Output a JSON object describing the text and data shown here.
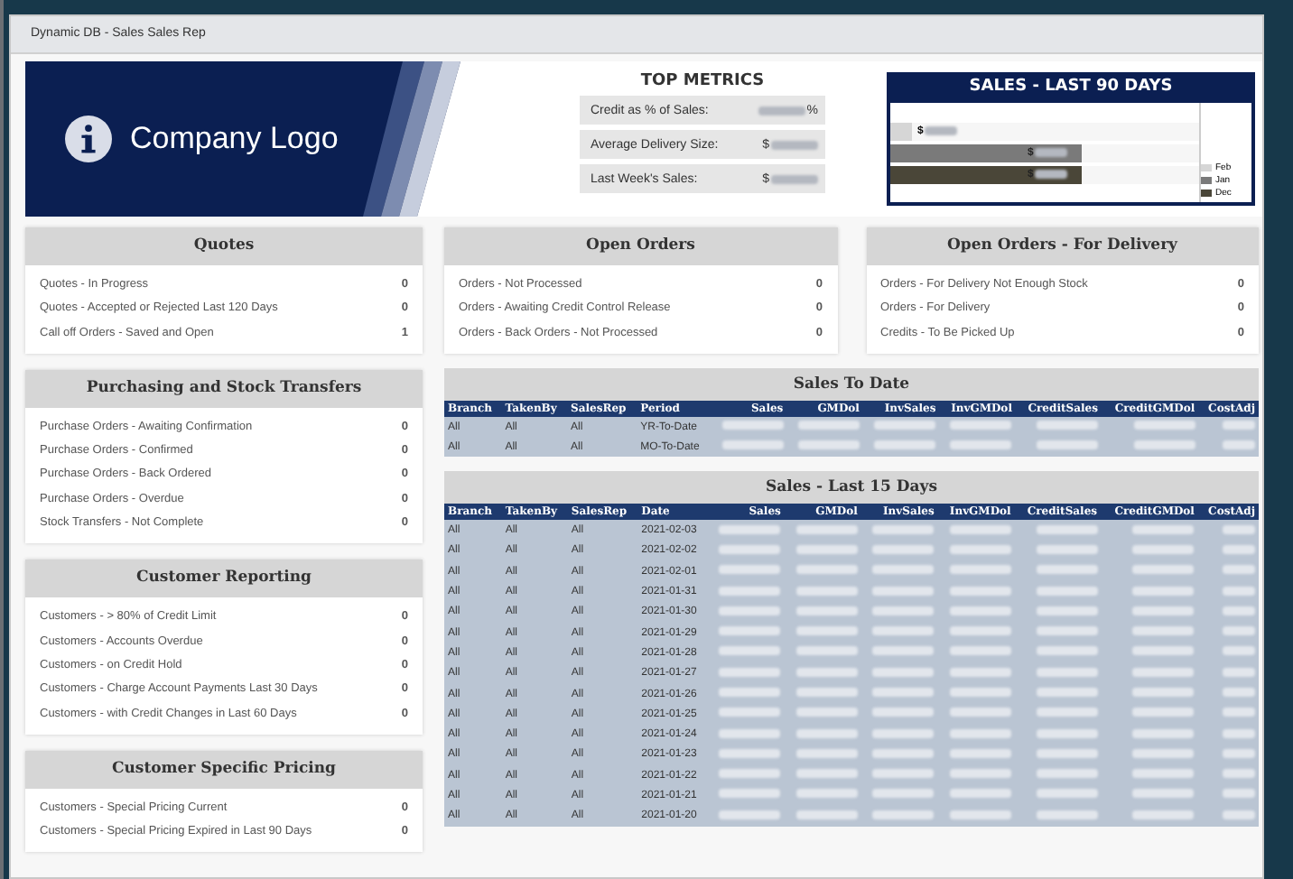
{
  "window": {
    "title": "Dynamic DB - Sales Sales Rep"
  },
  "logo": {
    "text": "Company Logo"
  },
  "top_metrics": {
    "title": "TOP METRICS",
    "items": [
      {
        "label": "Credit as % of Sales:",
        "suffix": "%"
      },
      {
        "label": "Average Delivery Size:",
        "prefix": "$"
      },
      {
        "label": "Last Week's Sales:",
        "prefix": "$"
      }
    ]
  },
  "sales_chart": {
    "title": "SALES - LAST 90 DAYS",
    "bars": [
      {
        "label": "$",
        "color": "#d6d6d6",
        "level": 0.07,
        "legend": "Feb"
      },
      {
        "label": "$",
        "color": "#7a7a7a",
        "level": 0.62,
        "legend": "Jan"
      },
      {
        "label": "$",
        "color": "#4a4638",
        "level": 0.62,
        "legend": "Dec"
      }
    ]
  },
  "left_panels": [
    {
      "title": "Quotes",
      "rows": [
        {
          "label": "Quotes - In Progress",
          "value": "0"
        },
        {
          "label": "Quotes - Accepted or Rejected Last 120 Days",
          "value": "0"
        },
        {
          "label": "Call off Orders - Saved and Open",
          "value": "1"
        }
      ]
    },
    {
      "title": "Purchasing and Stock Transfers",
      "rows": [
        {
          "label": "Purchase Orders - Awaiting Confirmation",
          "value": "0"
        },
        {
          "label": "Purchase Orders - Confirmed",
          "value": "0"
        },
        {
          "label": "Purchase Orders - Back Ordered",
          "value": "0"
        },
        {
          "label": "Purchase Orders - Overdue",
          "value": "0"
        },
        {
          "label": "Stock Transfers - Not Complete",
          "value": "0"
        }
      ]
    },
    {
      "title": "Customer Reporting",
      "rows": [
        {
          "label": "Customers - > 80% of Credit Limit",
          "value": "0"
        },
        {
          "label": "Customers - Accounts Overdue",
          "value": "0"
        },
        {
          "label": "Customers - on Credit Hold",
          "value": "0"
        },
        {
          "label": "Customers - Charge Account Payments Last 30 Days",
          "value": "0"
        },
        {
          "label": "Customers - with Credit Changes in Last 60 Days",
          "value": "0"
        }
      ]
    },
    {
      "title": "Customer Specific Pricing",
      "rows": [
        {
          "label": "Customers - Special Pricing Current",
          "value": "0"
        },
        {
          "label": "Customers - Special Pricing Expired in Last 90 Days",
          "value": "0"
        }
      ]
    }
  ],
  "top_panels": [
    {
      "title": "Open Orders",
      "rows": [
        {
          "label": "Orders - Not Processed",
          "value": "0"
        },
        {
          "label": "Orders - Awaiting Credit Control Release",
          "value": "0"
        },
        {
          "label": "Orders - Back Orders - Not Processed",
          "value": "0"
        }
      ]
    },
    {
      "title": "Open Orders - For Delivery",
      "rows": [
        {
          "label": "Orders - For Delivery Not Enough Stock",
          "value": "0"
        },
        {
          "label": "Orders - For Delivery",
          "value": "0"
        },
        {
          "label": "Credits - To Be Picked Up",
          "value": "0"
        }
      ]
    }
  ],
  "tables": [
    {
      "title": "Sales To Date",
      "columns": [
        "Branch",
        "TakenBy",
        "SalesRep",
        "Period",
        "Sales",
        "GMDol",
        "InvSales",
        "InvGMDol",
        "CreditSales",
        "CreditGMDol",
        "CostAdj"
      ],
      "rows": [
        [
          "All",
          "All",
          "All",
          "YR-To-Date"
        ],
        [
          "All",
          "All",
          "All",
          "MO-To-Date"
        ]
      ]
    },
    {
      "title": "Sales - Last 15 Days",
      "columns": [
        "Branch",
        "TakenBy",
        "SalesRep",
        "Date",
        "Sales",
        "GMDol",
        "InvSales",
        "InvGMDol",
        "CreditSales",
        "CreditGMDol",
        "CostAdj"
      ],
      "rows": [
        [
          "All",
          "All",
          "All",
          "2021-02-03"
        ],
        [
          "All",
          "All",
          "All",
          "2021-02-02"
        ],
        [
          "All",
          "All",
          "All",
          "2021-02-01"
        ],
        [
          "All",
          "All",
          "All",
          "2021-01-31"
        ],
        [
          "All",
          "All",
          "All",
          "2021-01-30"
        ],
        [
          "All",
          "All",
          "All",
          "2021-01-29"
        ],
        [
          "All",
          "All",
          "All",
          "2021-01-28"
        ],
        [
          "All",
          "All",
          "All",
          "2021-01-27"
        ],
        [
          "All",
          "All",
          "All",
          "2021-01-26"
        ],
        [
          "All",
          "All",
          "All",
          "2021-01-25"
        ],
        [
          "All",
          "All",
          "All",
          "2021-01-24"
        ],
        [
          "All",
          "All",
          "All",
          "2021-01-23"
        ],
        [
          "All",
          "All",
          "All",
          "2021-01-22"
        ],
        [
          "All",
          "All",
          "All",
          "2021-01-21"
        ],
        [
          "All",
          "All",
          "All",
          "2021-01-20"
        ]
      ]
    }
  ]
}
